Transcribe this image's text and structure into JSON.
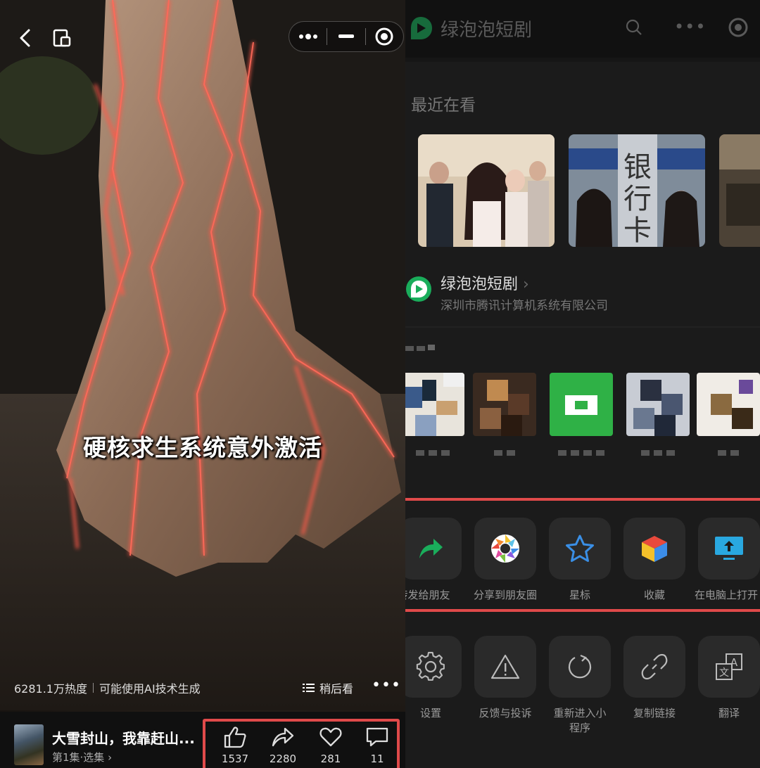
{
  "left": {
    "subtitle": "硬核求生系统意外激活",
    "heat": "6281.1万热度",
    "ai_note": "可能使用AI技术生成",
    "watch_later": "稍后看",
    "drama_title": "大雪封山，我靠赶山...",
    "episode": "第1集·选集",
    "actions": [
      {
        "icon": "thumbs-up-icon",
        "count": "1537"
      },
      {
        "icon": "share-arrow-icon",
        "count": "2280"
      },
      {
        "icon": "heart-icon",
        "count": "281"
      },
      {
        "icon": "comment-icon",
        "count": "11"
      }
    ],
    "accent_color": "#e04a4a"
  },
  "right": {
    "header_title": "绿泡泡短剧",
    "recent_label": "最近在看",
    "thumb_text": "银行卡",
    "app_name": "绿泡泡短剧",
    "app_company": "深圳市腾讯计算机系统有限公司",
    "brand_color": "#1aad5b",
    "menu_row1": [
      {
        "label": "转发给朋友",
        "icon": "forward-icon"
      },
      {
        "label": "分享到朋友圈",
        "icon": "moments-icon"
      },
      {
        "label": "星标",
        "icon": "star-icon"
      },
      {
        "label": "收藏",
        "icon": "collect-cube-icon"
      },
      {
        "label": "在电脑上打开",
        "icon": "monitor-upload-icon"
      }
    ],
    "menu_row2": [
      {
        "label": "设置",
        "icon": "gear-icon"
      },
      {
        "label": "反馈与投诉",
        "icon": "warning-icon"
      },
      {
        "label": "重新进入小程序",
        "icon": "reload-icon"
      },
      {
        "label": "复制链接",
        "icon": "link-icon"
      },
      {
        "label": "翻译",
        "icon": "translate-icon"
      }
    ]
  }
}
